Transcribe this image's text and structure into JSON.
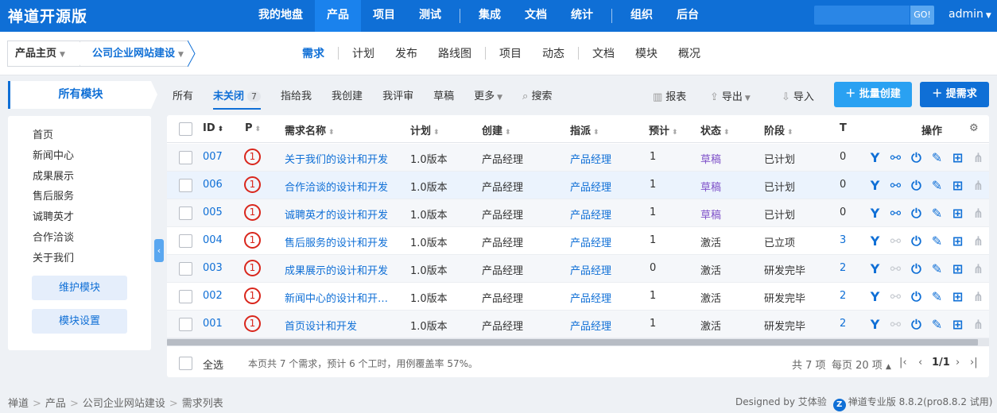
{
  "topbar": {
    "brand": "禅道开源版",
    "nav": [
      "我的地盘",
      "产品",
      "项目",
      "测试",
      "集成",
      "文档",
      "统计",
      "组织",
      "后台"
    ],
    "active": "产品",
    "search_go": "GO!",
    "user": "admin"
  },
  "subbar": {
    "crumb_home": "产品主页",
    "crumb_project": "公司企业网站建设",
    "nav": [
      "需求",
      "计划",
      "发布",
      "路线图",
      "项目",
      "动态",
      "文档",
      "模块",
      "概况"
    ],
    "active": "需求"
  },
  "sidebar": {
    "header": "所有模块",
    "modules": [
      "首页",
      "新闻中心",
      "成果展示",
      "售后服务",
      "诚聘英才",
      "合作洽谈",
      "关于我们"
    ],
    "maintain_button": "维护模块",
    "settings_button": "模块设置"
  },
  "filters": {
    "tabs": [
      "所有",
      "未关闭",
      "指给我",
      "我创建",
      "我评审",
      "草稿"
    ],
    "active": "未关闭",
    "unclosed_count": "7",
    "more": "更多",
    "search": "搜索",
    "report": "报表",
    "export": "导出",
    "import": "导入",
    "batch_create": "批量创建",
    "create": "提需求"
  },
  "table": {
    "columns": [
      "ID",
      "P",
      "需求名称",
      "计划",
      "创建",
      "指派",
      "预计",
      "状态",
      "阶段",
      "T",
      "操作"
    ],
    "rows": [
      {
        "id": "007",
        "pri": "1",
        "title": "关于我们的设计和开发",
        "plan": "1.0版本",
        "creator": "产品经理",
        "assignee": "产品经理",
        "estimate": "1",
        "status": "草稿",
        "stage": "已计划",
        "tasks": "0"
      },
      {
        "id": "006",
        "pri": "1",
        "title": "合作洽谈的设计和开发",
        "plan": "1.0版本",
        "creator": "产品经理",
        "assignee": "产品经理",
        "estimate": "1",
        "status": "草稿",
        "stage": "已计划",
        "tasks": "0"
      },
      {
        "id": "005",
        "pri": "1",
        "title": "诚聘英才的设计和开发",
        "plan": "1.0版本",
        "creator": "产品经理",
        "assignee": "产品经理",
        "estimate": "1",
        "status": "草稿",
        "stage": "已计划",
        "tasks": "0"
      },
      {
        "id": "004",
        "pri": "1",
        "title": "售后服务的设计和开发",
        "plan": "1.0版本",
        "creator": "产品经理",
        "assignee": "产品经理",
        "estimate": "1",
        "status": "激活",
        "stage": "已立项",
        "tasks": "3"
      },
      {
        "id": "003",
        "pri": "1",
        "title": "成果展示的设计和开发",
        "plan": "1.0版本",
        "creator": "产品经理",
        "assignee": "产品经理",
        "estimate": "0",
        "status": "激活",
        "stage": "研发完毕",
        "tasks": "2"
      },
      {
        "id": "002",
        "pri": "1",
        "title": "新闻中心的设计和开…",
        "plan": "1.0版本",
        "creator": "产品经理",
        "assignee": "产品经理",
        "estimate": "1",
        "status": "激活",
        "stage": "研发完毕",
        "tasks": "2"
      },
      {
        "id": "001",
        "pri": "1",
        "title": "首页设计和开发",
        "plan": "1.0版本",
        "creator": "产品经理",
        "assignee": "产品经理",
        "estimate": "1",
        "status": "激活",
        "stage": "研发完毕",
        "tasks": "2"
      }
    ],
    "select_all": "全选",
    "summary": "本页共 7 个需求，预计 6 个工时，用例覆盖率 57%。",
    "total": "共 7 项",
    "per_page": "每页 20 项",
    "page": "1/1"
  },
  "footer": {
    "crumbs": [
      "禅道",
      "产品",
      "公司企业网站建设",
      "需求列表"
    ],
    "designed_by": "Designed by 艾体验",
    "version": "禅道专业版 8.8.2(pro8.8.2 试用)"
  },
  "colors": {
    "primary": "#0f6fd6",
    "priority": "#d9261c",
    "draft": "#7f52c9"
  }
}
